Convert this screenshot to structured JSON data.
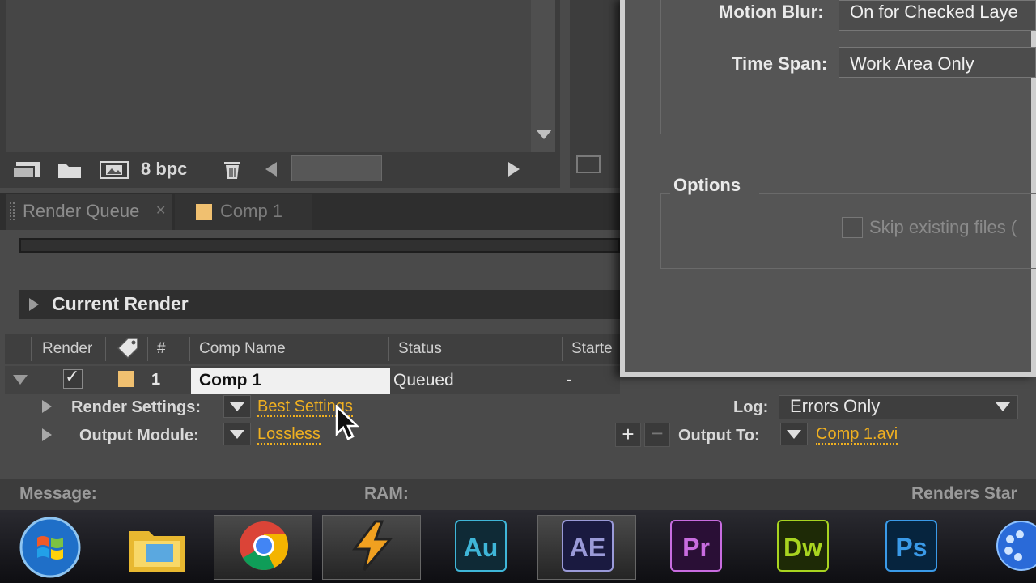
{
  "project_panel": {
    "bpc": "8 bpc"
  },
  "tabs": [
    {
      "label": "Render Queue"
    },
    {
      "label": "Comp 1"
    }
  ],
  "current_render": {
    "label": "Current Render"
  },
  "table": {
    "headers": {
      "render": "Render",
      "num": "#",
      "comp_name": "Comp Name",
      "status": "Status",
      "started": "Starte"
    },
    "row": {
      "num": "1",
      "comp_name": "Comp 1",
      "status": "Queued",
      "started": "-"
    }
  },
  "render_settings": {
    "label": "Render Settings:",
    "value": "Best Settings"
  },
  "output_module": {
    "label": "Output Module:",
    "value": "Lossless"
  },
  "log": {
    "label": "Log:",
    "value": "Errors Only"
  },
  "output_to": {
    "label": "Output To:",
    "value": "Comp 1.avi"
  },
  "status_bar": {
    "message": "Message:",
    "ram": "RAM:",
    "renders_started": "Renders Star"
  },
  "dialog": {
    "motion_blur_label": "Motion Blur:",
    "motion_blur_value": "On for Checked Laye",
    "time_span_label": "Time Span:",
    "time_span_value": "Work Area Only",
    "options_label": "Options",
    "skip_existing_label": "Skip existing files ("
  },
  "taskbar": {
    "apps": [
      {
        "name": "start",
        "icon": "windows-orb-icon"
      },
      {
        "name": "explorer",
        "icon": "folder-icon"
      },
      {
        "name": "chrome",
        "icon": "chrome-icon"
      },
      {
        "name": "winamp",
        "icon": "winamp-icon"
      },
      {
        "name": "audition",
        "label": "Au",
        "color": "#3fb6d8"
      },
      {
        "name": "after-effects",
        "label": "AE",
        "color": "#9a9ad8"
      },
      {
        "name": "premiere",
        "label": "Pr",
        "color": "#c86ce0"
      },
      {
        "name": "dreamweaver",
        "label": "Dw",
        "color": "#a8d420"
      },
      {
        "name": "photoshop",
        "label": "Ps",
        "color": "#3a9ae8"
      }
    ]
  },
  "colors": {
    "link": "#f0b020",
    "label_swatch": "#f0c070"
  }
}
